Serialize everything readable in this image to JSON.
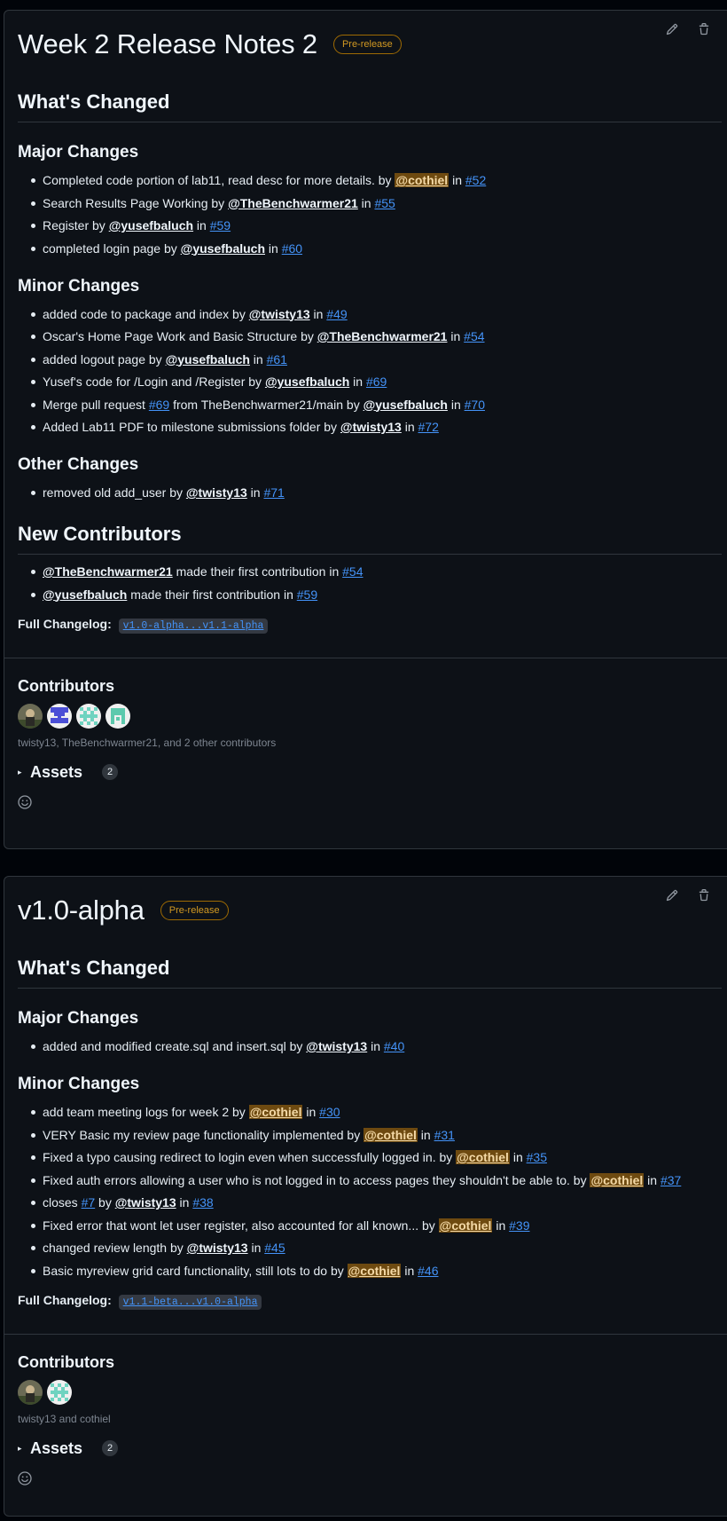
{
  "releases": [
    {
      "title": "Week 2 Release Notes 2",
      "badge": "Pre-release",
      "whats_changed": "What's Changed",
      "sections": [
        {
          "heading": "Major Changes",
          "items": [
            [
              {
                "t": "Completed code portion of lab11, read desc for more details. by "
              },
              {
                "u": "@cothiel",
                "hl": true
              },
              {
                "t": " in "
              },
              {
                "pr": "#52"
              }
            ],
            [
              {
                "t": "Search Results Page Working by "
              },
              {
                "u": "@TheBenchwarmer21"
              },
              {
                "t": " in "
              },
              {
                "pr": "#55"
              }
            ],
            [
              {
                "t": "Register by "
              },
              {
                "u": "@yusefbaluch"
              },
              {
                "t": " in "
              },
              {
                "pr": "#59"
              }
            ],
            [
              {
                "t": "completed login page by "
              },
              {
                "u": "@yusefbaluch"
              },
              {
                "t": " in "
              },
              {
                "pr": "#60"
              }
            ]
          ]
        },
        {
          "heading": "Minor Changes",
          "items": [
            [
              {
                "t": "added code to package and index by "
              },
              {
                "u": "@twisty13"
              },
              {
                "t": " in "
              },
              {
                "pr": "#49"
              }
            ],
            [
              {
                "t": "Oscar's Home Page Work and Basic Structure by "
              },
              {
                "u": "@TheBenchwarmer21"
              },
              {
                "t": " in "
              },
              {
                "pr": "#54"
              }
            ],
            [
              {
                "t": "added logout page by "
              },
              {
                "u": "@yusefbaluch"
              },
              {
                "t": " in "
              },
              {
                "pr": "#61"
              }
            ],
            [
              {
                "t": "Yusef's code for /Login and /Register by "
              },
              {
                "u": "@yusefbaluch"
              },
              {
                "t": " in "
              },
              {
                "pr": "#69"
              }
            ],
            [
              {
                "t": "Merge pull request "
              },
              {
                "pr": "#69"
              },
              {
                "t": " from TheBenchwarmer21/main by "
              },
              {
                "u": "@yusefbaluch"
              },
              {
                "t": " in "
              },
              {
                "pr": "#70"
              }
            ],
            [
              {
                "t": "Added Lab11 PDF to milestone submissions folder by "
              },
              {
                "u": "@twisty13"
              },
              {
                "t": " in "
              },
              {
                "pr": "#72"
              }
            ]
          ]
        },
        {
          "heading": "Other Changes",
          "items": [
            [
              {
                "t": "removed old add_user by "
              },
              {
                "u": "@twisty13"
              },
              {
                "t": " in "
              },
              {
                "pr": "#71"
              }
            ]
          ]
        }
      ],
      "new_contributors": {
        "heading": "New Contributors",
        "items": [
          [
            {
              "u": "@TheBenchwarmer21"
            },
            {
              "t": " made their first contribution in "
            },
            {
              "pr": "#54"
            }
          ],
          [
            {
              "u": "@yusefbaluch"
            },
            {
              "t": " made their first contribution in "
            },
            {
              "pr": "#59"
            }
          ]
        ]
      },
      "changelog_label": "Full Changelog:",
      "changelog_code": "v1.0-alpha...v1.1-alpha",
      "contributors_heading": "Contributors",
      "avatars": [
        "twisty13-avatar",
        "TheBenchwarmer21-avatar",
        "cothiel-avatar",
        "yusefbaluch-avatar"
      ],
      "contributors_text": "twisty13, TheBenchwarmer21, and 2 other contributors",
      "assets_label": "Assets",
      "assets_count": "2"
    },
    {
      "title": "v1.0-alpha",
      "badge": "Pre-release",
      "whats_changed": "What's Changed",
      "sections": [
        {
          "heading": "Major Changes",
          "items": [
            [
              {
                "t": "added and modified create.sql and insert.sql by "
              },
              {
                "u": "@twisty13"
              },
              {
                "t": " in "
              },
              {
                "pr": "#40"
              }
            ]
          ]
        },
        {
          "heading": "Minor Changes",
          "items": [
            [
              {
                "t": "add team meeting logs for week 2 by "
              },
              {
                "u": "@cothiel",
                "hl": true
              },
              {
                "t": " in "
              },
              {
                "pr": "#30"
              }
            ],
            [
              {
                "t": "VERY Basic my review page functionality implemented by "
              },
              {
                "u": "@cothiel",
                "hl": true
              },
              {
                "t": " in "
              },
              {
                "pr": "#31"
              }
            ],
            [
              {
                "t": "Fixed a typo causing redirect to login even when successfully logged in. by "
              },
              {
                "u": "@cothiel",
                "hl": true
              },
              {
                "t": " in "
              },
              {
                "pr": "#35"
              }
            ],
            [
              {
                "t": "Fixed auth errors allowing a user who is not logged in to access pages they shouldn't be able to. by "
              },
              {
                "u": "@cothiel",
                "hl": true
              },
              {
                "t": " in "
              },
              {
                "pr": "#37"
              }
            ],
            [
              {
                "t": "closes "
              },
              {
                "pr": "#7"
              },
              {
                "t": " by "
              },
              {
                "u": "@twisty13"
              },
              {
                "t": " in "
              },
              {
                "pr": "#38"
              }
            ],
            [
              {
                "t": "Fixed error that wont let user register, also accounted for all known... by "
              },
              {
                "u": "@cothiel",
                "hl": true
              },
              {
                "t": " in "
              },
              {
                "pr": "#39"
              }
            ],
            [
              {
                "t": "changed review length by "
              },
              {
                "u": "@twisty13"
              },
              {
                "t": " in "
              },
              {
                "pr": "#45"
              }
            ],
            [
              {
                "t": "Basic myreview grid card functionality, still lots to do by "
              },
              {
                "u": "@cothiel",
                "hl": true
              },
              {
                "t": " in "
              },
              {
                "pr": "#46"
              }
            ]
          ]
        }
      ],
      "new_contributors": null,
      "changelog_label": "Full Changelog:",
      "changelog_code": "v1.1-beta...v1.0-alpha",
      "contributors_heading": "Contributors",
      "avatars": [
        "twisty13-avatar",
        "cothiel-avatar"
      ],
      "contributors_text": "twisty13 and cothiel",
      "assets_label": "Assets",
      "assets_count": "2"
    }
  ],
  "colors": {
    "link": "#4493f8",
    "highlight": "#6e4a10",
    "badge": "#d29922",
    "muted": "#7d8590"
  },
  "icons": [
    "pencil-icon",
    "trash-icon",
    "triangle-right-icon",
    "smiley-icon"
  ]
}
